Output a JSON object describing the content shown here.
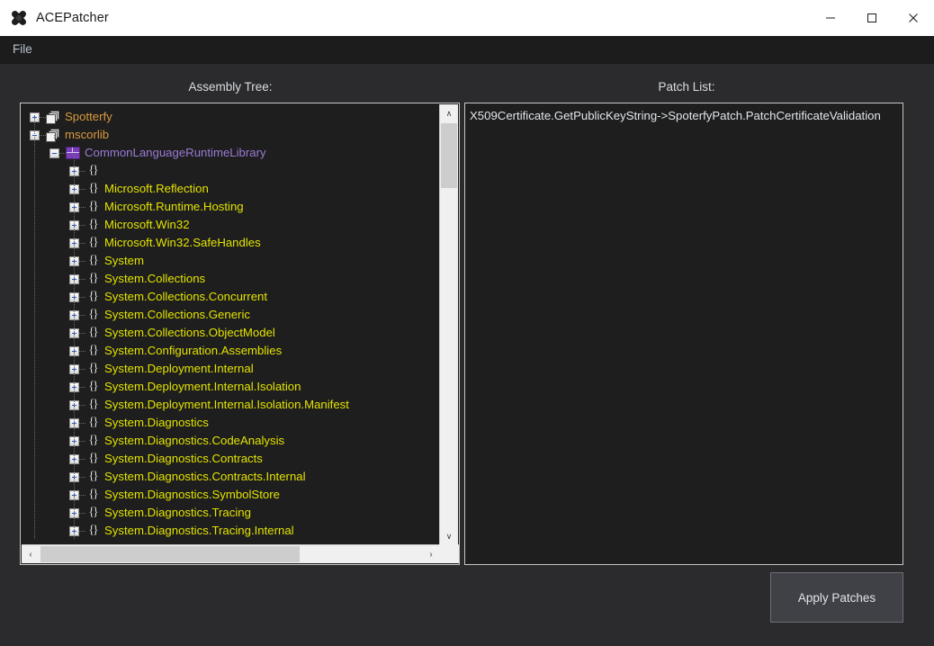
{
  "window": {
    "title": "ACEPatcher",
    "app_icon": "bandage-cross-icon",
    "minimize_label": "—",
    "maximize_label": "□",
    "close_label": "✕"
  },
  "menubar": {
    "items": [
      {
        "label": "File"
      }
    ]
  },
  "panels": {
    "tree_label": "Assembly Tree:",
    "patch_label": "Patch List:"
  },
  "tree": {
    "nodes": [
      {
        "label": "Spotterfy",
        "kind": "assembly",
        "depth": 0,
        "expander": "plus"
      },
      {
        "label": "mscorlib",
        "kind": "assembly",
        "depth": 0,
        "expander": "minus"
      },
      {
        "label": "CommonLanguageRuntimeLibrary",
        "kind": "module",
        "depth": 1,
        "expander": "minus"
      },
      {
        "label": "",
        "kind": "namespace",
        "depth": 2,
        "expander": "plus"
      },
      {
        "label": "Microsoft.Reflection",
        "kind": "namespace",
        "depth": 2,
        "expander": "plus"
      },
      {
        "label": "Microsoft.Runtime.Hosting",
        "kind": "namespace",
        "depth": 2,
        "expander": "plus"
      },
      {
        "label": "Microsoft.Win32",
        "kind": "namespace",
        "depth": 2,
        "expander": "plus"
      },
      {
        "label": "Microsoft.Win32.SafeHandles",
        "kind": "namespace",
        "depth": 2,
        "expander": "plus"
      },
      {
        "label": "System",
        "kind": "namespace",
        "depth": 2,
        "expander": "plus"
      },
      {
        "label": "System.Collections",
        "kind": "namespace",
        "depth": 2,
        "expander": "plus"
      },
      {
        "label": "System.Collections.Concurrent",
        "kind": "namespace",
        "depth": 2,
        "expander": "plus"
      },
      {
        "label": "System.Collections.Generic",
        "kind": "namespace",
        "depth": 2,
        "expander": "plus"
      },
      {
        "label": "System.Collections.ObjectModel",
        "kind": "namespace",
        "depth": 2,
        "expander": "plus"
      },
      {
        "label": "System.Configuration.Assemblies",
        "kind": "namespace",
        "depth": 2,
        "expander": "plus"
      },
      {
        "label": "System.Deployment.Internal",
        "kind": "namespace",
        "depth": 2,
        "expander": "plus"
      },
      {
        "label": "System.Deployment.Internal.Isolation",
        "kind": "namespace",
        "depth": 2,
        "expander": "plus"
      },
      {
        "label": "System.Deployment.Internal.Isolation.Manifest",
        "kind": "namespace",
        "depth": 2,
        "expander": "plus"
      },
      {
        "label": "System.Diagnostics",
        "kind": "namespace",
        "depth": 2,
        "expander": "plus"
      },
      {
        "label": "System.Diagnostics.CodeAnalysis",
        "kind": "namespace",
        "depth": 2,
        "expander": "plus"
      },
      {
        "label": "System.Diagnostics.Contracts",
        "kind": "namespace",
        "depth": 2,
        "expander": "plus"
      },
      {
        "label": "System.Diagnostics.Contracts.Internal",
        "kind": "namespace",
        "depth": 2,
        "expander": "plus"
      },
      {
        "label": "System.Diagnostics.SymbolStore",
        "kind": "namespace",
        "depth": 2,
        "expander": "plus"
      },
      {
        "label": "System.Diagnostics.Tracing",
        "kind": "namespace",
        "depth": 2,
        "expander": "plus"
      },
      {
        "label": "System.Diagnostics.Tracing.Internal",
        "kind": "namespace",
        "depth": 2,
        "expander": "plus"
      }
    ],
    "scroll": {
      "up_arrow": "∧",
      "down_arrow": "∨",
      "left_arrow": "‹",
      "right_arrow": "›"
    }
  },
  "patch_list": {
    "items": [
      {
        "label": "X509Certificate.GetPublicKeyString->SpoterfyPatch.PatchCertificateValidation"
      }
    ]
  },
  "actions": {
    "apply_label": "Apply Patches"
  },
  "colors": {
    "window_bg": "#2b2b2d",
    "titlebar_bg": "#ffffff",
    "menubar_bg": "#1c1c1c",
    "panel_bg": "#1e1e1e",
    "assembly_text": "#d99a3c",
    "module_text": "#9a7bd6",
    "namespace_text": "#e3e300",
    "patch_text": "#e2e6ea",
    "button_bg": "#3f4147"
  }
}
